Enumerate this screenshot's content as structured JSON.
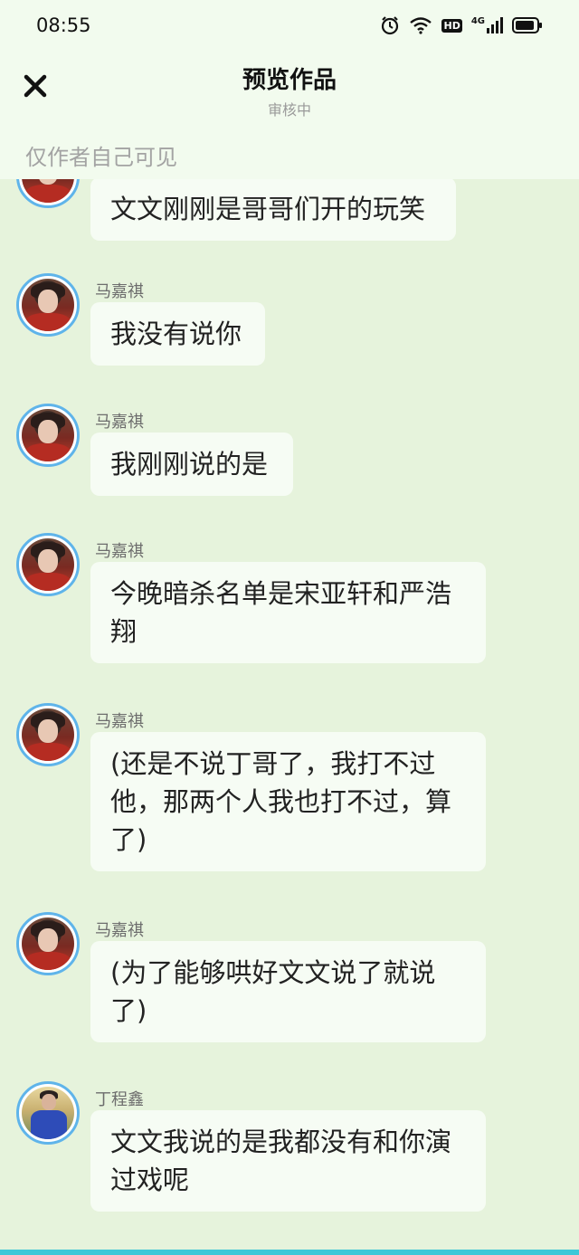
{
  "status_bar": {
    "time": "08:55",
    "icons": [
      "alarm-icon",
      "wifi-icon",
      "hd-icon",
      "signal-4g-icon",
      "battery-icon"
    ],
    "hd_label": "HD",
    "network_label": "4G"
  },
  "header": {
    "title": "预览作品",
    "subtitle": "审核中",
    "visibility_note": "仅作者自己可见"
  },
  "messages": [
    {
      "name": "",
      "text": "文文刚刚是哥哥们开的玩笑"
    },
    {
      "name": "马嘉祺",
      "text": "我没有说你"
    },
    {
      "name": "马嘉祺",
      "text": "我刚刚说的是"
    },
    {
      "name": "马嘉祺",
      "text": "今晚暗杀名单是宋亚轩和严浩翔"
    },
    {
      "name": "马嘉祺",
      "text": "(还是不说丁哥了，我打不过他，那两个人我也打不过，算了)"
    },
    {
      "name": "马嘉祺",
      "text": "(为了能够哄好文文说了就说了)"
    },
    {
      "name": "丁程鑫",
      "text": "文文我说的是我都没有和你演过戏呢"
    }
  ],
  "colors": {
    "background": "#e6f3dc",
    "bubble": "#f6fcf4",
    "avatar_ring": "#5fb4ea",
    "bottom_accent": "#3cc8d8"
  }
}
